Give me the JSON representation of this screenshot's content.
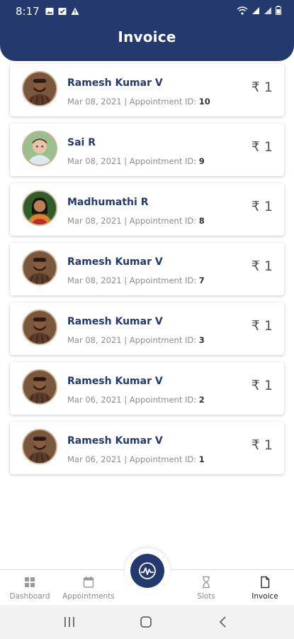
{
  "status_bar": {
    "time": "8:17",
    "left_icons": [
      "image-icon",
      "check-icon",
      "alert-icon"
    ],
    "right_icons": [
      "wifi-icon",
      "signal-icon",
      "signal-icon",
      "battery-icon"
    ]
  },
  "header": {
    "title": "Invoice"
  },
  "colors": {
    "primary": "#243a6e",
    "name_text": "#243a6e",
    "meta_text": "#8c8c8c"
  },
  "invoices": [
    {
      "name": "Ramesh Kumar V",
      "date": "Mar 08, 2021",
      "appointment_label": "Appointment ID:",
      "appointment_id": "10",
      "amount": "₹ 1",
      "avatar": "man-avatar"
    },
    {
      "name": "Sai R",
      "date": "Mar 08, 2021",
      "appointment_label": "Appointment ID:",
      "appointment_id": "9",
      "amount": "₹ 1",
      "avatar": "child-avatar"
    },
    {
      "name": "Madhumathi R",
      "date": "Mar 08, 2021",
      "appointment_label": "Appointment ID:",
      "appointment_id": "8",
      "amount": "₹ 1",
      "avatar": "woman-avatar"
    },
    {
      "name": "Ramesh Kumar V",
      "date": "Mar 08, 2021",
      "appointment_label": "Appointment ID:",
      "appointment_id": "7",
      "amount": "₹ 1",
      "avatar": "man-avatar"
    },
    {
      "name": "Ramesh Kumar V",
      "date": "Mar 08, 2021",
      "appointment_label": "Appointment ID:",
      "appointment_id": "3",
      "amount": "₹ 1",
      "avatar": "man-avatar"
    },
    {
      "name": "Ramesh Kumar V",
      "date": "Mar 06, 2021",
      "appointment_label": "Appointment ID:",
      "appointment_id": "2",
      "amount": "₹ 1",
      "avatar": "man-avatar"
    },
    {
      "name": "Ramesh Kumar V",
      "date": "Mar 06, 2021",
      "appointment_label": "Appointment ID:",
      "appointment_id": "1",
      "amount": "₹ 1",
      "avatar": "man-avatar"
    }
  ],
  "bottom_nav": {
    "items": [
      {
        "label": "Dashboard",
        "icon": "grid-icon",
        "active": false
      },
      {
        "label": "Appointments",
        "icon": "calendar-icon",
        "active": false
      },
      {
        "label": "Slots",
        "icon": "hourglass-icon",
        "active": false
      },
      {
        "label": "Invoice",
        "icon": "document-icon",
        "active": true
      }
    ],
    "center_button_icon": "logo-icon"
  },
  "system_nav": [
    "recents-icon",
    "home-icon",
    "back-icon"
  ]
}
